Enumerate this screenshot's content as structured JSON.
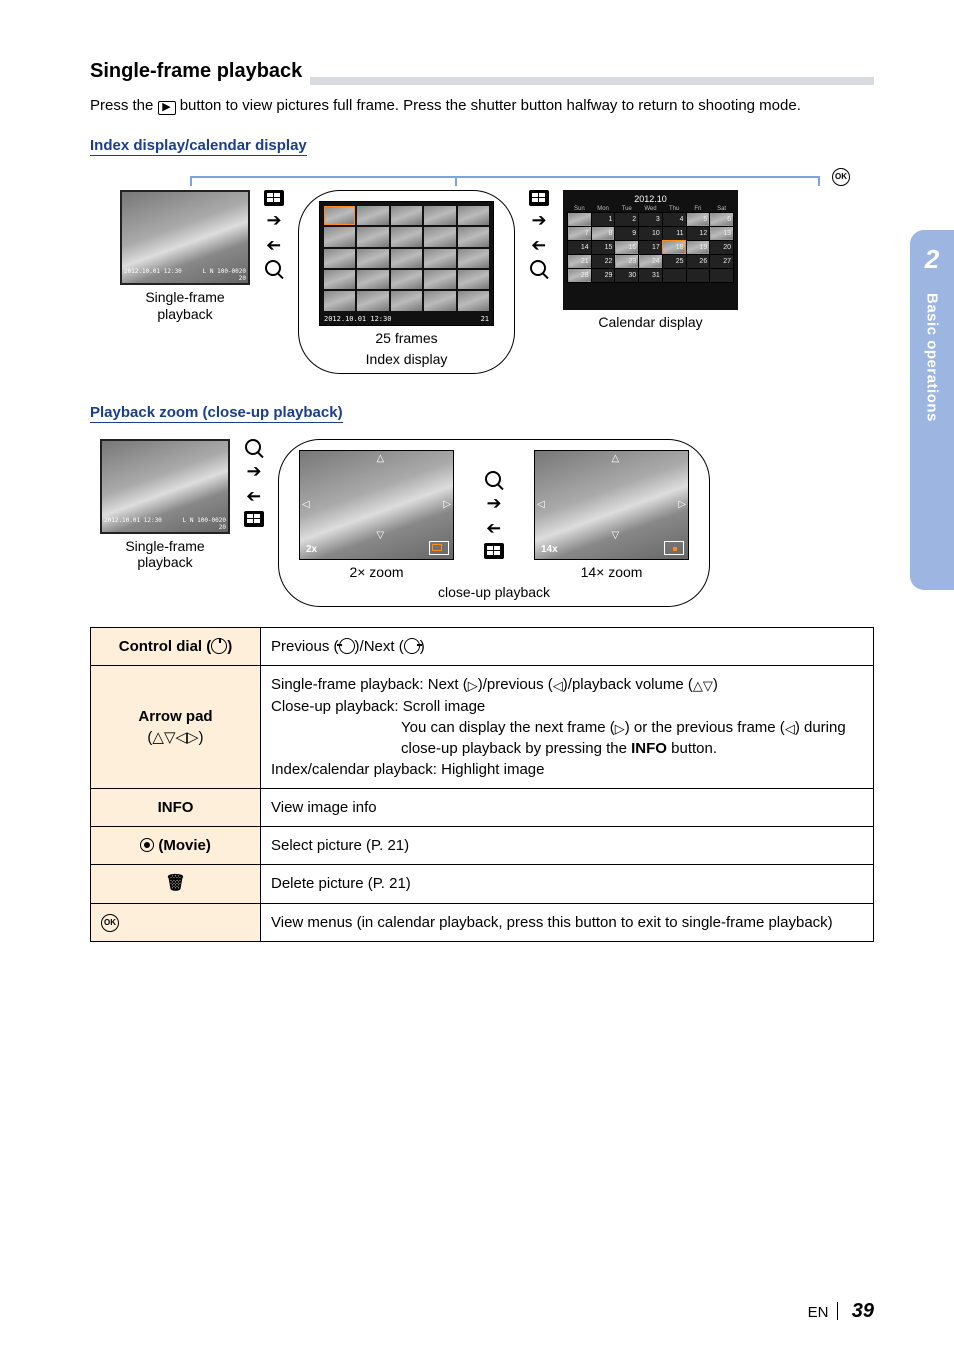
{
  "sideTab": {
    "number": "2",
    "label": "Basic operations"
  },
  "footer": {
    "lang": "EN",
    "page": "39"
  },
  "section": {
    "title": "Single-frame playback"
  },
  "intro": {
    "pre": "Press the ",
    "post": " button to view pictures full frame. Press the shutter button halfway to return to shooting mode."
  },
  "indexSection": {
    "heading": "Index display/calendar display",
    "thumb1": {
      "left": "2012.10.01 12:30",
      "right_top": "L N 100-0020",
      "right_bottom": "20",
      "caption": "Single-frame\nplayback"
    },
    "gridThumb": {
      "left": "2012.10.01 12:30",
      "right": "21",
      "caption": "25 frames"
    },
    "calThumb": {
      "head": "2012.10",
      "days": [
        "Sun",
        "Mon",
        "Tue",
        "Wed",
        "Thu",
        "Fri",
        "Sat"
      ],
      "rows": [
        [
          "",
          "1",
          "2",
          "3",
          "4",
          "5",
          "6"
        ],
        [
          "7",
          "8",
          "9",
          "10",
          "11",
          "12",
          "13"
        ],
        [
          "14",
          "15",
          "16",
          "17",
          "18",
          "19",
          "20"
        ],
        [
          "21",
          "22",
          "23",
          "24",
          "25",
          "26",
          "27"
        ],
        [
          "28",
          "29",
          "30",
          "31",
          "",
          "",
          ""
        ]
      ],
      "caption": "Calendar display"
    },
    "bubbleCaption": "Index display",
    "okIcon": "OK"
  },
  "zoomSection": {
    "heading": "Playback zoom (close-up playback)",
    "thumb": {
      "left": "2012.10.01 12:30",
      "right_top": "L N 100-0020",
      "right_bottom": "20",
      "caption": "Single-frame\nplayback"
    },
    "zoom1": {
      "label": "2x",
      "caption": "2× zoom"
    },
    "zoom2": {
      "label": "14x",
      "caption": "14× zoom"
    },
    "bubbleCaption": "close-up playback"
  },
  "table": {
    "r1": {
      "h": "Control dial (",
      "h_tail": ")",
      "c_pre": "Previous (",
      "c_mid": ")/Next (",
      "c_post": ")"
    },
    "r2": {
      "h_line1": "Arrow pad",
      "h_line2": "(△▽◁▷)",
      "l1_pre": "Single-frame playback: Next (",
      "l1_mid1": ")/previous (",
      "l1_mid2": ")/playback volume (",
      "l1_post": ")",
      "l2": "Close-up playback: Scroll image",
      "l3_pre": "You can display the next frame (",
      "l3_mid": ") or the previous frame (",
      "l3_mid2": ") during close-up playback by pressing the ",
      "l3_info": "INFO",
      "l3_post": " button.",
      "l4": "Index/calendar playback: Highlight image"
    },
    "r3": {
      "h": "INFO",
      "c": "View image info"
    },
    "r4": {
      "h_tail": " (Movie)",
      "c": "Select picture (P. 21)"
    },
    "r5": {
      "c": "Delete picture (P. 21)"
    },
    "r6": {
      "c": "View menus (in calendar playback, press this button to exit to single-frame playback)"
    }
  }
}
